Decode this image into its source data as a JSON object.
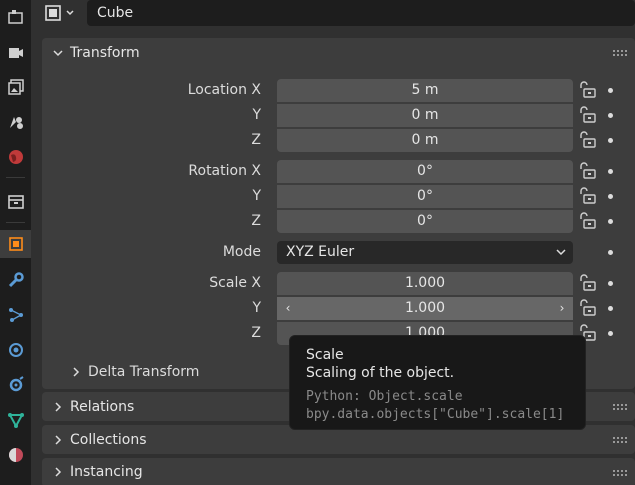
{
  "tabs": [
    {
      "icon": "tool-icon"
    },
    {
      "icon": "render-icon"
    },
    {
      "icon": "output-icon"
    },
    {
      "icon": "view-layer-icon"
    },
    {
      "icon": "scene-icon"
    },
    {
      "icon": "world-icon"
    },
    {
      "icon": "collection-icon"
    },
    {
      "icon": "object-icon",
      "active": true
    },
    {
      "icon": "modifier-icon"
    },
    {
      "icon": "particles-icon"
    },
    {
      "icon": "physics-icon"
    },
    {
      "icon": "constraints-icon"
    },
    {
      "icon": "data-icon"
    },
    {
      "icon": "material-icon"
    }
  ],
  "header": {
    "object_name": "Cube"
  },
  "transform": {
    "title": "Transform",
    "location": {
      "label_x": "Location X",
      "label_y": "Y",
      "label_z": "Z",
      "x": "5 m",
      "y": "0 m",
      "z": "0 m"
    },
    "rotation": {
      "label_x": "Rotation X",
      "label_y": "Y",
      "label_z": "Z",
      "x": "0°",
      "y": "0°",
      "z": "0°"
    },
    "mode": {
      "label": "Mode",
      "value": "XYZ Euler"
    },
    "scale": {
      "label_x": "Scale X",
      "label_y": "Y",
      "label_z": "Z",
      "x": "1.000",
      "y": "1.000",
      "z": "1.000"
    },
    "delta": "Delta Transform"
  },
  "panels": {
    "relations": "Relations",
    "collections": "Collections",
    "instancing": "Instancing"
  },
  "tooltip": {
    "title": "Scale",
    "description": "Scaling of the object.",
    "python_1": "Python: Object.scale",
    "python_2": "bpy.data.objects[\"Cube\"].scale[1]"
  },
  "colors": {
    "accent": "#ff8c1a",
    "field": "#545454",
    "panel": "#3d3d3d"
  }
}
